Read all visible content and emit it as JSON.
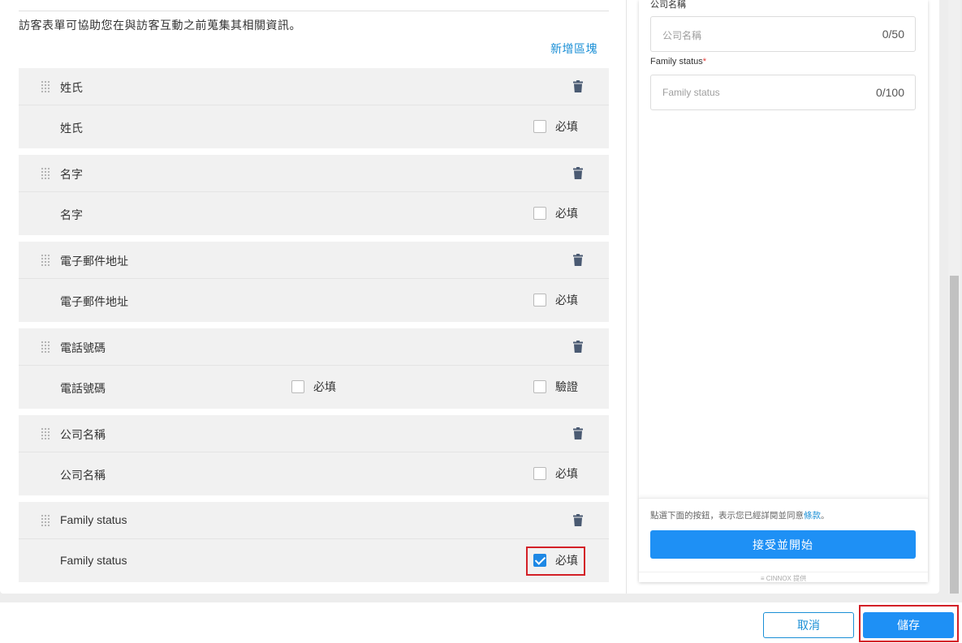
{
  "form": {
    "description": "訪客表單可協助您在與訪客互動之前蒐集其相關資訊。",
    "add_section_label": "新增區塊",
    "required_label": "必填",
    "verify_label": "驗證",
    "fields": [
      {
        "title": "姓氏",
        "name": "姓氏",
        "required": false
      },
      {
        "title": "名字",
        "name": "名字",
        "required": false
      },
      {
        "title": "電子郵件地址",
        "name": "電子郵件地址",
        "required": false
      },
      {
        "title": "電話號碼",
        "name": "電話號碼",
        "required": false,
        "verify": false
      },
      {
        "title": "公司名稱",
        "name": "公司名稱",
        "required": false
      },
      {
        "title": "Family status",
        "name": "Family status",
        "required": true
      }
    ]
  },
  "preview": {
    "company_label": "公司名稱",
    "company_placeholder": "公司名稱",
    "company_count": "0/50",
    "family_label": "Family status",
    "family_placeholder": "Family status",
    "family_count": "0/100",
    "terms_prefix": "點選下面的按鈕，表示您已經詳閱並同意",
    "terms_link": "條款",
    "terms_suffix": "。",
    "start_button": "接受並開始",
    "powered_by": "≡ CINNOX 提供"
  },
  "footer": {
    "cancel_label": "取消",
    "save_label": "儲存"
  },
  "colors": {
    "accent": "#1e90f5",
    "highlight": "#d32027",
    "block_bg": "#f1f1f1"
  }
}
